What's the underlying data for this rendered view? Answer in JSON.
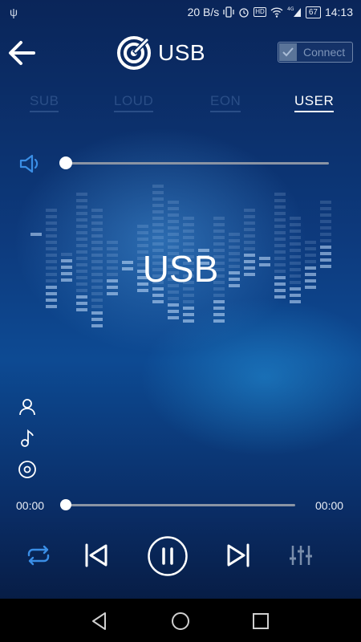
{
  "status_bar": {
    "network_speed": "20 B/s",
    "battery": "67",
    "time": "14:13",
    "icons": [
      "usb-icon",
      "vibrate-icon",
      "alarm-icon",
      "hd-icon",
      "wifi-icon",
      "signal-4g-icon",
      "battery-icon"
    ]
  },
  "header": {
    "title": "USB",
    "connect_label": "Connect",
    "connect_checked": true
  },
  "tabs": [
    {
      "label": "SUB",
      "active": false
    },
    {
      "label": "LOUD",
      "active": false
    },
    {
      "label": "EON",
      "active": false
    },
    {
      "label": "USER",
      "active": true
    }
  ],
  "volume": {
    "level": 0.0
  },
  "source_name": "USB",
  "side_icons": [
    "artist-icon",
    "song-icon",
    "album-icon"
  ],
  "playback": {
    "current_time": "00:00",
    "total_time": "00:00",
    "progress": 0.0
  },
  "controls": [
    "repeat-icon",
    "previous-icon",
    "pause-icon",
    "next-icon",
    "equalizer-icon"
  ],
  "colors": {
    "accent": "#3a8ee6",
    "tab_inactive": "#2a4e87",
    "background": "#0d3a7d"
  }
}
